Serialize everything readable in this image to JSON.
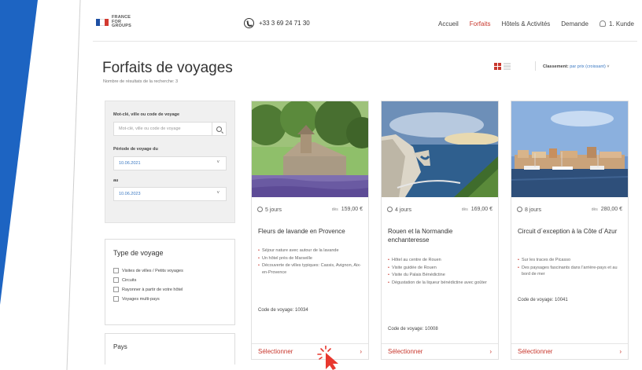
{
  "brand": {
    "logo_lines": [
      "FRANCE",
      "FOR",
      "GROUPS"
    ],
    "flag_colors": [
      "#1d4fa3",
      "#ffffff",
      "#d23a30"
    ]
  },
  "header": {
    "phone": "+33 3 69 24 71 30",
    "nav": [
      "Accueil",
      "Forfaits",
      "Hôtels & Activités",
      "Demande"
    ],
    "active_nav": "Forfaits",
    "user": "1. Kunde"
  },
  "page": {
    "title": "Forfaits de voyages",
    "results": "Nombre de résultats de la recherche: 3"
  },
  "sort": {
    "label": "Classement:",
    "value": "par prix (croissant)",
    "arrow": "˅"
  },
  "filters": {
    "keyword_label": "Mot-clé, ville ou code de voyage",
    "keyword_placeholder": "Mot-clé, ville ou code de voyage",
    "period_label": "Période de voyage du",
    "date_from": "10.06.2021",
    "to_label": "au",
    "date_to": "10.06.2023",
    "caret": "˅",
    "type_title": "Type de voyage",
    "types": [
      "Visites de villes / Petits voyages",
      "Circuits",
      "Rayonner à partir de votre hôtel",
      "Voyages multi-pays"
    ],
    "country_title": "Pays"
  },
  "cards": [
    {
      "duration": "5 jours",
      "price_prefix": "dès",
      "price": "159,00 €",
      "title": "Fleurs de lavande en Provence",
      "bullets": [
        "Séjour nature avec autour de la lavande",
        "Un hôtel près de Marseille",
        "Découverte de villes typiques: Cassis, Avignon, Aix-en-Provence"
      ],
      "code": "Code de voyage: 10034",
      "select": "Sélectionner",
      "arrow": "›"
    },
    {
      "duration": "4 jours",
      "price_prefix": "dès",
      "price": "169,00 €",
      "title": "Rouen et la Normandie enchanteresse",
      "bullets": [
        "Hôtel au centre de Rouen",
        "Visite guidée de Rouen",
        "Visite du Palais Bénédictine",
        "Dégustation de la liqueur bénédictine avec goûter"
      ],
      "code": "Code de voyage: 10008",
      "select": "Sélectionner",
      "arrow": "›"
    },
    {
      "duration": "8 jours",
      "price_prefix": "dès",
      "price": "280,00 €",
      "title": "Circuit d´exception à la Côte d´Azur",
      "bullets": [
        "Sur les traces de Picasso",
        "Des paysages fascinants dans l'arrière-pays et au bord de mer"
      ],
      "code": "Code de voyage: 10041",
      "select": "Sélectionner",
      "arrow": "›"
    }
  ],
  "colors": {
    "accent": "#c8372d",
    "link": "#3a78c2",
    "decor_blue": "#1d64c2"
  }
}
